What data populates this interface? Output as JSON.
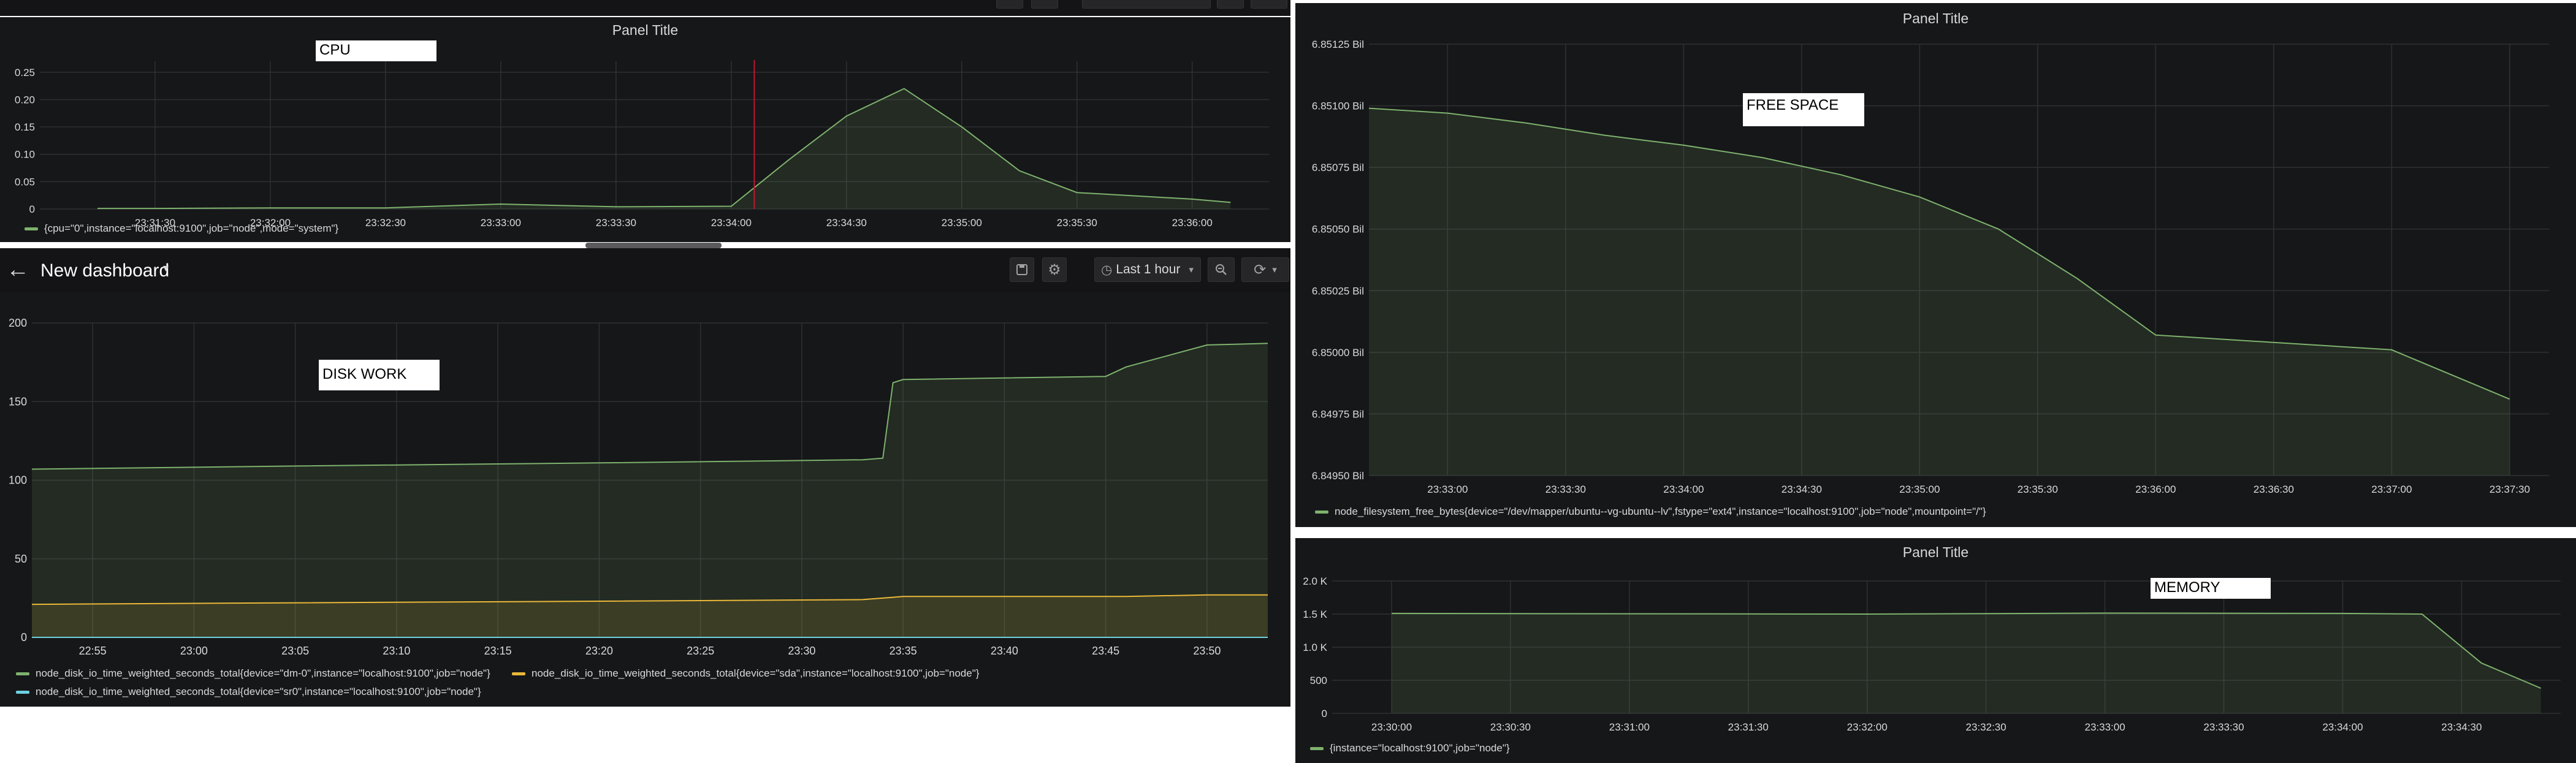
{
  "dashboard": {
    "title": "New dashboard",
    "time_range": "Last 1 hour"
  },
  "colors": {
    "green": "#7eb26d",
    "yellow": "#eab839",
    "cyan": "#6ed0e0",
    "bg": "#161719"
  },
  "icons": [
    "back-arrow-icon",
    "caret-down-icon",
    "save-icon",
    "gear-icon",
    "clock-icon",
    "zoom-out-icon",
    "refresh-icon"
  ],
  "panels": {
    "cpu": {
      "title": "Panel Title",
      "label": "CPU",
      "legend": [
        "{cpu=\"0\",instance=\"localhost:9100\",job=\"node\",mode=\"system\"}"
      ]
    },
    "disk": {
      "title": "Panel Title",
      "label": "DISK WORK",
      "legend": [
        "node_disk_io_time_weighted_seconds_total{device=\"dm-0\",instance=\"localhost:9100\",job=\"node\"}",
        "node_disk_io_time_weighted_seconds_total{device=\"sda\",instance=\"localhost:9100\",job=\"node\"}",
        "node_disk_io_time_weighted_seconds_total{device=\"sr0\",instance=\"localhost:9100\",job=\"node\"}"
      ]
    },
    "free": {
      "title": "Panel Title",
      "label": "FREE SPACE",
      "legend": [
        "node_filesystem_free_bytes{device=\"/dev/mapper/ubuntu--vg-ubuntu--lv\",fstype=\"ext4\",instance=\"localhost:9100\",job=\"node\",mountpoint=\"/\"}"
      ]
    },
    "memory": {
      "title": "Panel Title",
      "label": "MEMORY",
      "legend": [
        "{instance=\"localhost:9100\",job=\"node\"}"
      ]
    }
  },
  "chart_data": [
    {
      "id": "cpu",
      "type": "area",
      "x": [
        "23:31:15",
        "23:31:30",
        "23:32:00",
        "23:32:30",
        "23:33:00",
        "23:33:30",
        "23:34:00",
        "23:34:15",
        "23:34:30",
        "23:34:45",
        "23:35:00",
        "23:35:15",
        "23:35:30",
        "23:36:00",
        "23:36:10"
      ],
      "series": [
        {
          "name": "{cpu=\"0\",instance=\"localhost:9100\",job=\"node\",mode=\"system\"}",
          "values": [
            0.001,
            0.001,
            0.002,
            0.002,
            0.009,
            0.004,
            0.005,
            0.09,
            0.17,
            0.22,
            0.15,
            0.07,
            0.03,
            0.018,
            0.012
          ]
        }
      ],
      "x_ticks": [
        "23:31:30",
        "23:32:00",
        "23:32:30",
        "23:33:00",
        "23:33:30",
        "23:34:00",
        "23:34:30",
        "23:35:00",
        "23:35:30",
        "23:36:00"
      ],
      "y_ticks": [
        "0",
        "0.05",
        "0.10",
        "0.15",
        "0.20",
        "0.25"
      ],
      "ylim": [
        0,
        0.27
      ],
      "grid": true,
      "legend_position": "bottom-left"
    },
    {
      "id": "disk",
      "type": "line",
      "x": [
        "22:52",
        "23:05",
        "23:20",
        "23:33",
        "23:34",
        "23:34.5",
        "23:35",
        "23:45",
        "23:46",
        "23:50",
        "23:53"
      ],
      "series": [
        {
          "name": "node_disk_io_time_weighted_seconds_total{device=\"dm-0\",instance=\"localhost:9100\",job=\"node\"}",
          "values": [
            107,
            109,
            111,
            113,
            114,
            162,
            164,
            166,
            172,
            186,
            187
          ]
        },
        {
          "name": "node_disk_io_time_weighted_seconds_total{device=\"sda\",instance=\"localhost:9100\",job=\"node\"}",
          "values": [
            21,
            22,
            23,
            24,
            25,
            25.5,
            26,
            26,
            26,
            27,
            27
          ]
        },
        {
          "name": "node_disk_io_time_weighted_seconds_total{device=\"sr0\",instance=\"localhost:9100\",job=\"node\"}",
          "values": [
            0,
            0,
            0,
            0,
            0,
            0,
            0,
            0,
            0,
            0,
            0
          ]
        }
      ],
      "x_ticks": [
        "22:55",
        "23:00",
        "23:05",
        "23:10",
        "23:15",
        "23:20",
        "23:25",
        "23:30",
        "23:35",
        "23:40",
        "23:45",
        "23:50"
      ],
      "y_ticks": [
        "0",
        "50",
        "100",
        "150",
        "200"
      ],
      "ylim": [
        0,
        200
      ],
      "grid": true,
      "legend_position": "bottom-left"
    },
    {
      "id": "free",
      "type": "area",
      "x": [
        "23:32:40",
        "23:33:00",
        "23:33:20",
        "23:33:40",
        "23:34:00",
        "23:34:20",
        "23:34:40",
        "23:35:00",
        "23:35:20",
        "23:35:40",
        "23:36:00",
        "23:37:00",
        "23:37:30"
      ],
      "series": [
        {
          "name": "node_filesystem_free_bytes{device=\"/dev/mapper/ubuntu--vg-ubuntu--lv\",fstype=\"ext4\",instance=\"localhost:9100\",job=\"node\",mountpoint=\"/\"}",
          "values": [
            6.85099,
            6.85097,
            6.85093,
            6.85088,
            6.85084,
            6.85079,
            6.85072,
            6.85063,
            6.8505,
            6.8503,
            6.85007,
            6.85001,
            6.84981
          ]
        }
      ],
      "x_ticks": [
        "23:33:00",
        "23:33:30",
        "23:34:00",
        "23:34:30",
        "23:35:00",
        "23:35:30",
        "23:36:00",
        "23:36:30",
        "23:37:00",
        "23:37:30"
      ],
      "y_ticks": [
        "6.84950 Bil",
        "6.84975 Bil",
        "6.85000 Bil",
        "6.85025 Bil",
        "6.85050 Bil",
        "6.85075 Bil",
        "6.85100 Bil",
        "6.85125 Bil"
      ],
      "y_unit": "Bil",
      "ylim": [
        6.8495,
        6.85125
      ],
      "grid": true,
      "legend_position": "bottom-left"
    },
    {
      "id": "memory",
      "type": "area",
      "x": [
        "23:30:00",
        "23:31:00",
        "23:32:00",
        "23:33:00",
        "23:34:00",
        "23:34:20",
        "23:34:35",
        "23:34:50"
      ],
      "series": [
        {
          "name": "{instance=\"localhost:9100\",job=\"node\"}",
          "values": [
            1510,
            1505,
            1500,
            1515,
            1510,
            1500,
            760,
            380
          ]
        }
      ],
      "x_ticks": [
        "23:30:00",
        "23:30:30",
        "23:31:00",
        "23:31:30",
        "23:32:00",
        "23:32:30",
        "23:33:00",
        "23:33:30",
        "23:34:00",
        "23:34:30"
      ],
      "y_ticks": [
        "0",
        "500",
        "1.0 K",
        "1.5 K",
        "2.0 K"
      ],
      "ylim": [
        0,
        2000
      ],
      "grid": true,
      "legend_position": "bottom-left"
    }
  ]
}
